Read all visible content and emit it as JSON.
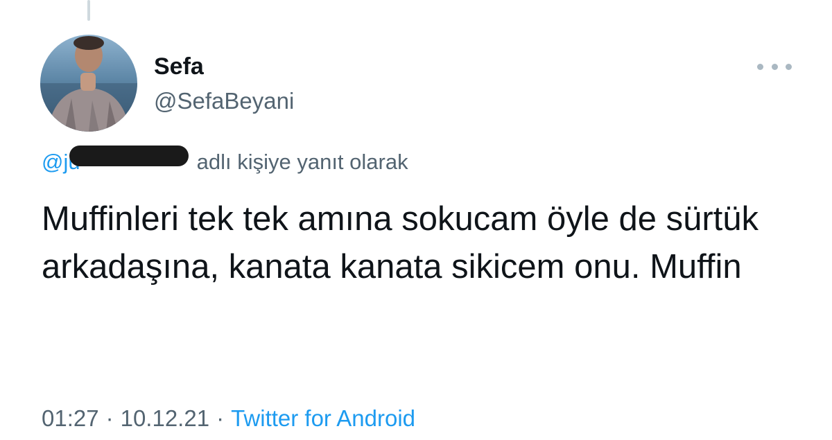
{
  "tweet": {
    "author_name": "Sefa",
    "author_handle": "@SefaBeyani",
    "reply_mention": "@ju",
    "reply_suffix": "adlı kişiye yanıt olarak",
    "text": "Muffinleri tek tek amına sokucam öyle de sürtük arkadaşına, kanata kanata sikicem onu. Muffin",
    "time": "01:27",
    "date": "10.12.21",
    "separator": "·",
    "source": "Twitter for Android"
  },
  "icons": {
    "more": "more-horizontal-icon"
  },
  "colors": {
    "text": "#0f1419",
    "secondary": "#536471",
    "link": "#1d9bf0"
  }
}
